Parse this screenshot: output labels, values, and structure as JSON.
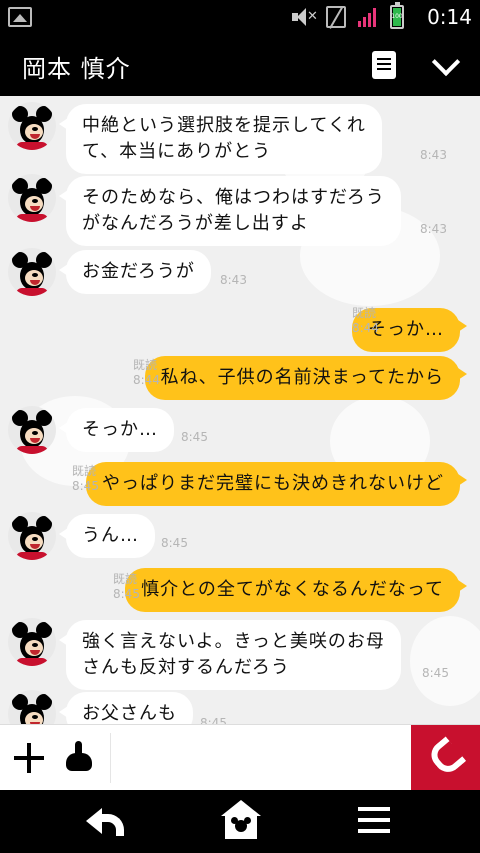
{
  "status_bar": {
    "time": "0:14",
    "battery_level": "100",
    "icons": [
      "gallery-icon",
      "mute-icon",
      "sim-icon",
      "signal-icon",
      "battery-icon"
    ]
  },
  "header": {
    "title": "岡本 慎介",
    "icons": [
      "notes-icon",
      "chevron-down-icon"
    ]
  },
  "messages": [
    {
      "side": "left",
      "lines": [
        "中絶という選択肢を提示してくれ",
        "て、本当にありがとう"
      ],
      "time": "8:43"
    },
    {
      "side": "left",
      "lines": [
        "そのためなら、俺はつわはすだろう",
        "がなんだろうが差し出すよ"
      ],
      "time": "8:43"
    },
    {
      "side": "left",
      "lines": [
        "お金だろうが"
      ],
      "time": "8:43"
    },
    {
      "side": "right",
      "lines": [
        "そっか…"
      ],
      "read": "既読",
      "time": "8:44"
    },
    {
      "side": "right",
      "lines": [
        "私ね、子供の名前決まってたから"
      ],
      "read": "既読",
      "time": "8:44"
    },
    {
      "side": "left",
      "lines": [
        "そっか…"
      ],
      "time": "8:45"
    },
    {
      "side": "right",
      "lines": [
        "やっぱりまだ完璧にも決めきれないけど"
      ],
      "read": "既読",
      "time": "8:45"
    },
    {
      "side": "left",
      "lines": [
        "うん…"
      ],
      "time": "8:45"
    },
    {
      "side": "right",
      "lines": [
        "慎介との全てがなくなるんだなって"
      ],
      "read": "既読",
      "time": "8:45"
    },
    {
      "side": "left",
      "lines": [
        "強く言えないよ。きっと美咲のお母",
        "さんも反対するんだろう"
      ],
      "time": "8:45"
    },
    {
      "side": "left",
      "lines": [
        "お父さんも"
      ],
      "time": "8:45"
    }
  ],
  "input_bar": {
    "placeholder": "",
    "icons": [
      "plus-icon",
      "sticker-icon",
      "phone-icon"
    ],
    "call_color": "#c8102e"
  },
  "nav_bar": {
    "icons": [
      "back-icon",
      "home-icon",
      "menu-icon"
    ]
  },
  "colors": {
    "outgoing_bubble": "#ffc21a",
    "incoming_bubble": "#ffffff",
    "chat_background": "#f0f0f0"
  }
}
